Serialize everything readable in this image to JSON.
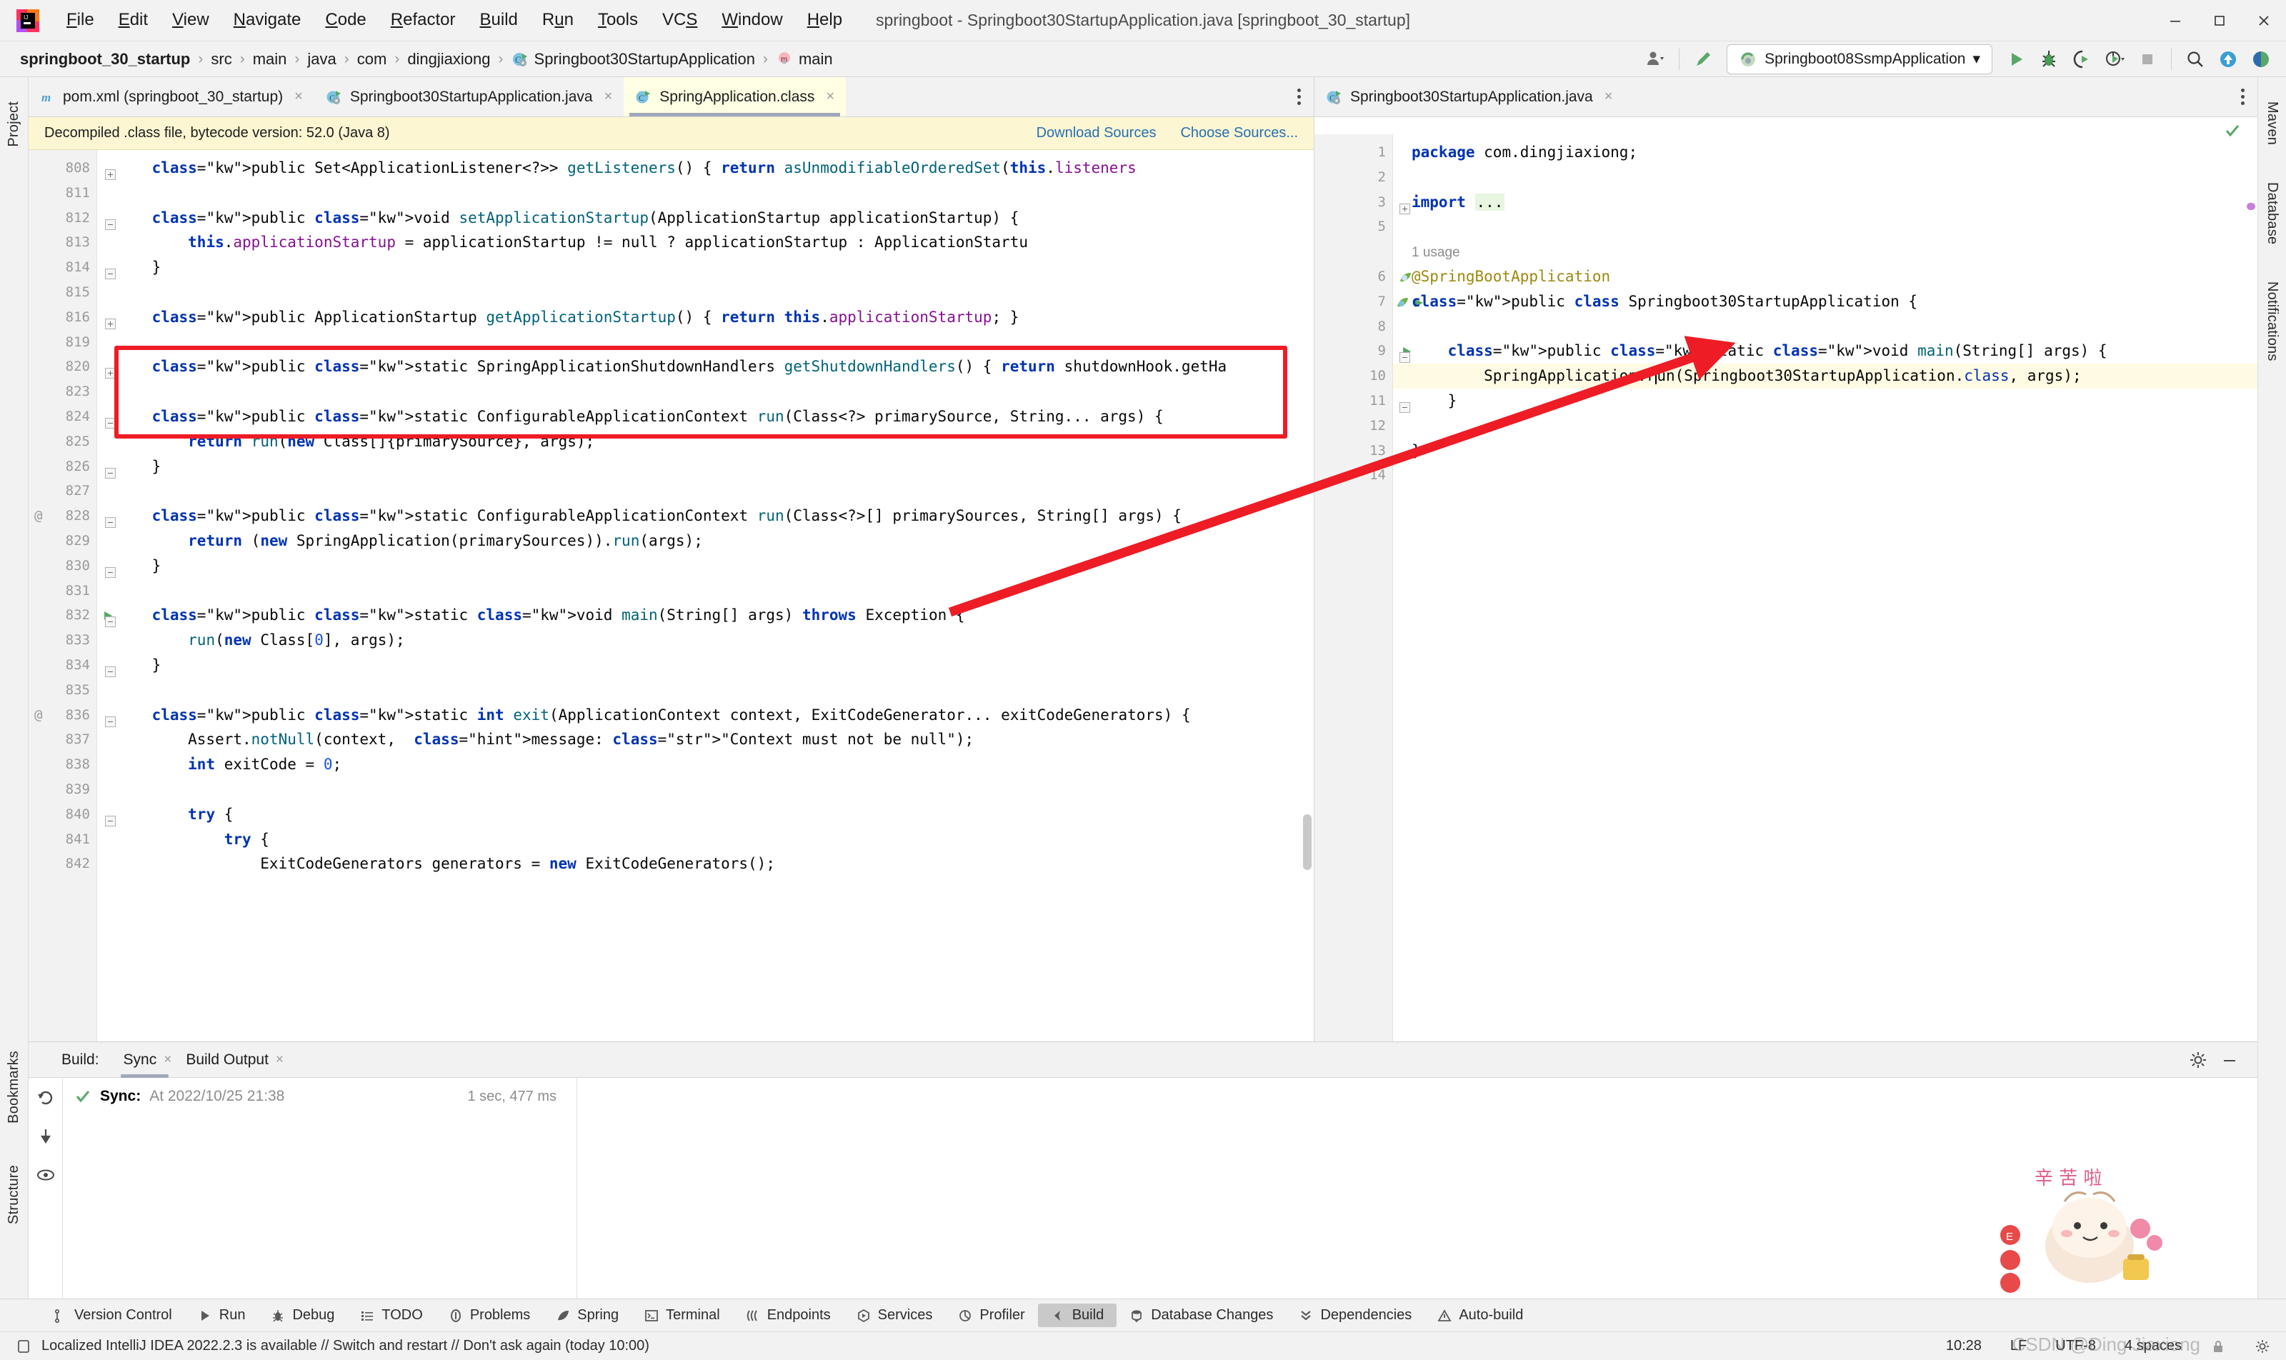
{
  "window": {
    "title": "springboot - Springboot30StartupApplication.java [springboot_30_startup]",
    "minimize": "–",
    "maximize": "□",
    "close": "✕"
  },
  "menu": {
    "items": [
      {
        "label": "File",
        "mnemonic_index": 0
      },
      {
        "label": "Edit",
        "mnemonic_index": 0
      },
      {
        "label": "View",
        "mnemonic_index": 0
      },
      {
        "label": "Navigate",
        "mnemonic_index": 0
      },
      {
        "label": "Code",
        "mnemonic_index": 0
      },
      {
        "label": "Refactor",
        "mnemonic_index": 0
      },
      {
        "label": "Build",
        "mnemonic_index": 0
      },
      {
        "label": "Run",
        "mnemonic_index": 1
      },
      {
        "label": "Tools",
        "mnemonic_index": 0
      },
      {
        "label": "VCS",
        "mnemonic_index": 2
      },
      {
        "label": "Window",
        "mnemonic_index": 0
      },
      {
        "label": "Help",
        "mnemonic_index": 0
      }
    ]
  },
  "breadcrumb": {
    "items": [
      {
        "label": "springboot_30_startup",
        "bold": true,
        "icon": null
      },
      {
        "label": "src",
        "bold": false,
        "icon": null
      },
      {
        "label": "main",
        "bold": false,
        "icon": null
      },
      {
        "label": "java",
        "bold": false,
        "icon": null
      },
      {
        "label": "com",
        "bold": false,
        "icon": null
      },
      {
        "label": "dingjiaxiong",
        "bold": false,
        "icon": null
      },
      {
        "label": "Springboot30StartupApplication",
        "bold": false,
        "icon": "class-icon"
      },
      {
        "label": "main",
        "bold": false,
        "icon": "method-icon"
      }
    ],
    "separator": "›"
  },
  "toolbar": {
    "run_configuration": "Springboot08SsmpApplication",
    "dropdown_caret": "▾",
    "buttons": [
      {
        "name": "user-icon",
        "label": ""
      },
      {
        "name": "build-hammer-icon",
        "label": ""
      },
      {
        "name": "run-icon",
        "label": ""
      },
      {
        "name": "debug-icon",
        "label": ""
      },
      {
        "name": "run-coverage-icon",
        "label": ""
      },
      {
        "name": "profiler-icon",
        "label": ""
      },
      {
        "name": "stop-icon",
        "label": ""
      },
      {
        "name": "search-everywhere-icon",
        "label": ""
      },
      {
        "name": "update-project-icon",
        "label": ""
      },
      {
        "name": "ide-assistant-icon",
        "label": ""
      }
    ]
  },
  "left_rail": {
    "tabs": [
      "Project",
      "Bookmarks",
      "Structure"
    ]
  },
  "right_rail": {
    "tabs": [
      "Maven",
      "Database",
      "Notifications"
    ]
  },
  "left_pane": {
    "tabs": [
      {
        "label": "pom.xml (springboot_30_startup)",
        "icon": "maven-icon",
        "active": false,
        "close": "×"
      },
      {
        "label": "Springboot30StartupApplication.java",
        "icon": "class-icon",
        "active": false,
        "close": "×"
      },
      {
        "label": "SpringApplication.class",
        "icon": "class-file-icon",
        "active": true,
        "close": "×"
      }
    ],
    "notice": {
      "text": "Decompiled .class file, bytecode version: 52.0 (Java 8)",
      "link_download": "Download Sources",
      "link_choose": "Choose Sources..."
    },
    "lines": [
      {
        "n": "808",
        "ann": "",
        "fold": "plus",
        "text": "    public Set<ApplicationListener<?>> getListeners() { return asUnmodifiableOrderedSet(this.listeners"
      },
      {
        "n": "811",
        "ann": "",
        "fold": "",
        "text": ""
      },
      {
        "n": "812",
        "ann": "",
        "fold": "minus",
        "text": "    public void setApplicationStartup(ApplicationStartup applicationStartup) {"
      },
      {
        "n": "813",
        "ann": "",
        "fold": "",
        "text": "        this.applicationStartup = applicationStartup != null ? applicationStartup : ApplicationStartu"
      },
      {
        "n": "814",
        "ann": "",
        "fold": "end",
        "text": "    }"
      },
      {
        "n": "815",
        "ann": "",
        "fold": "",
        "text": ""
      },
      {
        "n": "816",
        "ann": "",
        "fold": "plus",
        "text": "    public ApplicationStartup getApplicationStartup() { return this.applicationStartup; }"
      },
      {
        "n": "819",
        "ann": "",
        "fold": "",
        "text": ""
      },
      {
        "n": "820",
        "ann": "",
        "fold": "plus",
        "text": "    public static SpringApplicationShutdownHandlers getShutdownHandlers() { return shutdownHook.getHa"
      },
      {
        "n": "823",
        "ann": "",
        "fold": "",
        "text": ""
      },
      {
        "n": "824",
        "ann": "",
        "fold": "minus",
        "text": "    public static ConfigurableApplicationContext run(Class<?> primarySource, String... args) {"
      },
      {
        "n": "825",
        "ann": "",
        "fold": "",
        "text": "        return run(new Class[]{primarySource}, args);"
      },
      {
        "n": "826",
        "ann": "",
        "fold": "end",
        "text": "    }"
      },
      {
        "n": "827",
        "ann": "",
        "fold": "",
        "text": ""
      },
      {
        "n": "828",
        "ann": "@",
        "fold": "minus",
        "text": "    public static ConfigurableApplicationContext run(Class<?>[] primarySources, String[] args) {"
      },
      {
        "n": "829",
        "ann": "",
        "fold": "",
        "text": "        return (new SpringApplication(primarySources)).run(args);"
      },
      {
        "n": "830",
        "ann": "",
        "fold": "end",
        "text": "    }"
      },
      {
        "n": "831",
        "ann": "",
        "fold": "",
        "text": ""
      },
      {
        "n": "832",
        "ann": "",
        "fold": "minus",
        "text": "    public static void main(String[] args) throws Exception {"
      },
      {
        "n": "833",
        "ann": "",
        "fold": "",
        "text": "        run(new Class[0], args);"
      },
      {
        "n": "834",
        "ann": "",
        "fold": "end",
        "text": "    }"
      },
      {
        "n": "835",
        "ann": "",
        "fold": "",
        "text": ""
      },
      {
        "n": "836",
        "ann": "@",
        "fold": "minus",
        "text": "    public static int exit(ApplicationContext context, ExitCodeGenerator... exitCodeGenerators) {"
      },
      {
        "n": "837",
        "ann": "",
        "fold": "",
        "text": "        Assert.notNull(context,  message: \"Context must not be null\");"
      },
      {
        "n": "838",
        "ann": "",
        "fold": "",
        "text": "        int exitCode = 0;"
      },
      {
        "n": "839",
        "ann": "",
        "fold": "",
        "text": ""
      },
      {
        "n": "840",
        "ann": "",
        "fold": "minus",
        "text": "        try {"
      },
      {
        "n": "841",
        "ann": "",
        "fold": "",
        "text": "            try {"
      },
      {
        "n": "842",
        "ann": "",
        "fold": "",
        "text": "                ExitCodeGenerators generators = new ExitCodeGenerators();"
      }
    ],
    "line_832_has_run_marker": true
  },
  "right_pane": {
    "tab": {
      "label": "Springboot30StartupApplication.java",
      "icon": "class-icon",
      "close": "×"
    },
    "inspection_status": "✓",
    "usage_hint": "1 usage",
    "lines": [
      {
        "n": "1",
        "text": "package com.dingjiaxiong;",
        "hl": false
      },
      {
        "n": "2",
        "text": "",
        "hl": false
      },
      {
        "n": "3",
        "text": "import ...",
        "hl": false
      },
      {
        "n": "5",
        "text": "",
        "hl": false
      },
      {
        "n": "",
        "text": "1 usage",
        "hl": false
      },
      {
        "n": "6",
        "text": "@SpringBootApplication",
        "hl": false
      },
      {
        "n": "7",
        "text": "public class Springboot30StartupApplication {",
        "hl": false
      },
      {
        "n": "8",
        "text": "",
        "hl": false
      },
      {
        "n": "9",
        "text": "    public static void main(String[] args) {",
        "hl": false
      },
      {
        "n": "10",
        "text": "        SpringApplication.run(Springboot30StartupApplication.class, args);",
        "hl": true
      },
      {
        "n": "11",
        "text": "    }",
        "hl": false
      },
      {
        "n": "12",
        "text": "",
        "hl": false
      },
      {
        "n": "13",
        "text": "}",
        "hl": false
      },
      {
        "n": "14",
        "text": "",
        "hl": false
      }
    ]
  },
  "build_window": {
    "label": "Build:",
    "tabs": [
      {
        "label": "Sync",
        "active": true,
        "close": "×"
      },
      {
        "label": "Build Output",
        "active": false,
        "close": "×"
      }
    ],
    "settings_icon": "gear-icon",
    "minimize_icon": "minimize-icon",
    "row": {
      "status_icon": "✔",
      "title": "Sync:",
      "detail": "At 2022/10/25 21:38",
      "duration": "1 sec, 477 ms"
    },
    "sticker_text": "辛 苦 啦"
  },
  "tool_strip": {
    "items": [
      {
        "label": "Version Control",
        "icon": "branch-icon",
        "active": false
      },
      {
        "label": "Run",
        "icon": "run-icon",
        "active": false
      },
      {
        "label": "Debug",
        "icon": "debug-icon",
        "active": false
      },
      {
        "label": "TODO",
        "icon": "todo-icon",
        "active": false
      },
      {
        "label": "Problems",
        "icon": "problems-icon",
        "active": false
      },
      {
        "label": "Spring",
        "icon": "spring-leaf-icon",
        "active": false
      },
      {
        "label": "Terminal",
        "icon": "terminal-icon",
        "active": false
      },
      {
        "label": "Endpoints",
        "icon": "endpoints-icon",
        "active": false
      },
      {
        "label": "Services",
        "icon": "services-icon",
        "active": false
      },
      {
        "label": "Profiler",
        "icon": "profiler-icon",
        "active": false
      },
      {
        "label": "Build",
        "icon": "build-icon",
        "active": true
      },
      {
        "label": "Database Changes",
        "icon": "database-icon",
        "active": false
      },
      {
        "label": "Dependencies",
        "icon": "dependencies-icon",
        "active": false
      },
      {
        "label": "Auto-build",
        "icon": "autobuild-icon",
        "active": false
      }
    ]
  },
  "status_bar": {
    "message": "Localized IntelliJ IDEA 2022.2.3 is available // Switch and restart // Don't ask again (today 10:00)",
    "caret_position": "10:28",
    "line_separator": "LF",
    "encoding": "UTF-8",
    "indent": "4 spaces",
    "watermark": "CSDN @Ding Jiaxiong"
  },
  "colors": {
    "accent_red": "#ee1c25",
    "keyword_blue": "#0033b3",
    "method_teal": "#00627a",
    "field_purple": "#871094",
    "string_green": "#067d17",
    "annotation_gold": "#9e880d",
    "active_tab_bg": "#ffffe4",
    "notice_bg": "#fdf6d3",
    "current_line_bg": "#fffae3"
  }
}
